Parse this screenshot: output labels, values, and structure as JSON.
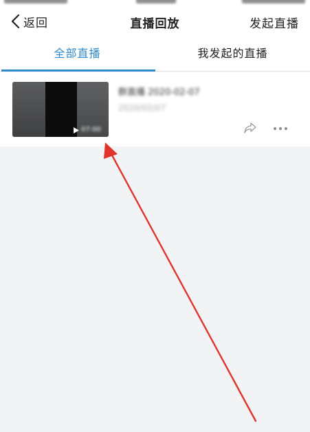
{
  "nav": {
    "back_label": "返回",
    "title": "直播回放",
    "start_live_label": "发起直播"
  },
  "tabs": [
    {
      "label": "全部直播",
      "active": true
    },
    {
      "label": "我发起的直播",
      "active": false
    }
  ],
  "list": {
    "items": [
      {
        "title": "群直播 2020-02-07",
        "date": "2020/02/07",
        "duration": "07:00",
        "actions": [
          "share-icon",
          "more-icon"
        ]
      }
    ]
  },
  "colors": {
    "accent": "#2f88c9",
    "background": "#f2f3f5",
    "annotation_arrow": "#e0342b"
  }
}
